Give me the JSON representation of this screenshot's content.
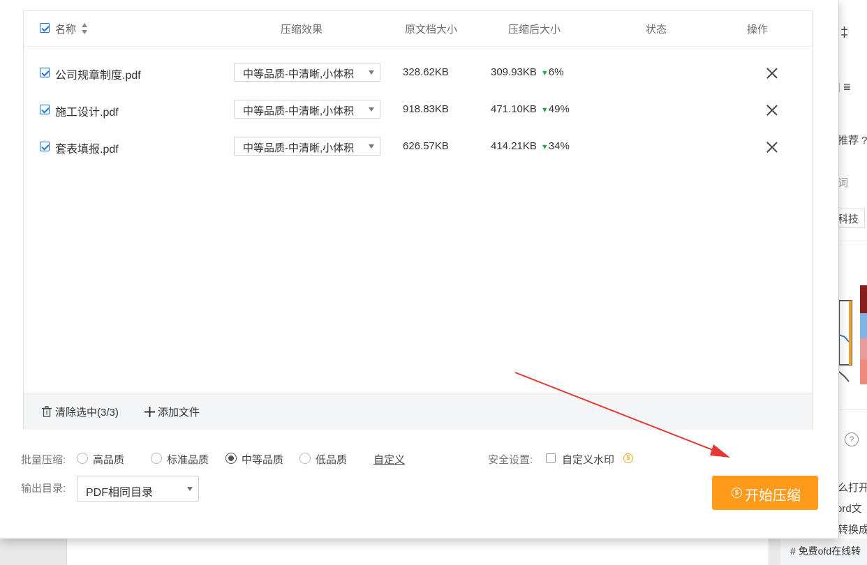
{
  "table": {
    "headers": {
      "name": "名称",
      "effect": "压缩效果",
      "orig_size": "原文档大小",
      "new_size": "压缩后大小",
      "status": "状态",
      "action": "操作"
    },
    "rows": [
      {
        "name": "公司规章制度.pdf",
        "quality": "中等品质-中清晰,小体积",
        "orig_size": "328.62KB",
        "new_size": "309.93KB",
        "reduction": "6%",
        "status": ""
      },
      {
        "name": "施工设计.pdf",
        "quality": "中等品质-中清晰,小体积",
        "orig_size": "918.83KB",
        "new_size": "471.10KB",
        "reduction": "49%",
        "status": ""
      },
      {
        "name": "套表填报.pdf",
        "quality": "中等品质-中清晰,小体积",
        "orig_size": "626.57KB",
        "new_size": "414.21KB",
        "reduction": "34%",
        "status": ""
      }
    ],
    "footer": {
      "clear_selected": "清除选中(3/3)",
      "add_file": "添加文件"
    }
  },
  "batch": {
    "label": "批量压缩:",
    "options": [
      "高品质",
      "标准品质",
      "中等品质",
      "低品质"
    ],
    "selected": "中等品质",
    "custom_link": "自定义"
  },
  "security": {
    "label": "安全设置:",
    "watermark": "自定义水印"
  },
  "output": {
    "label": "输出目录:",
    "value": "PDF相同目录"
  },
  "start_button": "开始压缩",
  "right_panel": {
    "fragments": [
      "‡",
      "| ≣",
      "推荐 ?",
      "词",
      "科技",
      "?",
      "么打开",
      "ord文",
      "转换成"
    ],
    "bottom_text": "# 免费ofd在线转"
  },
  "colors": {
    "accent_orange": "#ff9a1a",
    "checkbox_blue": "#1a73e8",
    "reduce_green": "#23a55a",
    "arrow_red": "#e53935"
  }
}
